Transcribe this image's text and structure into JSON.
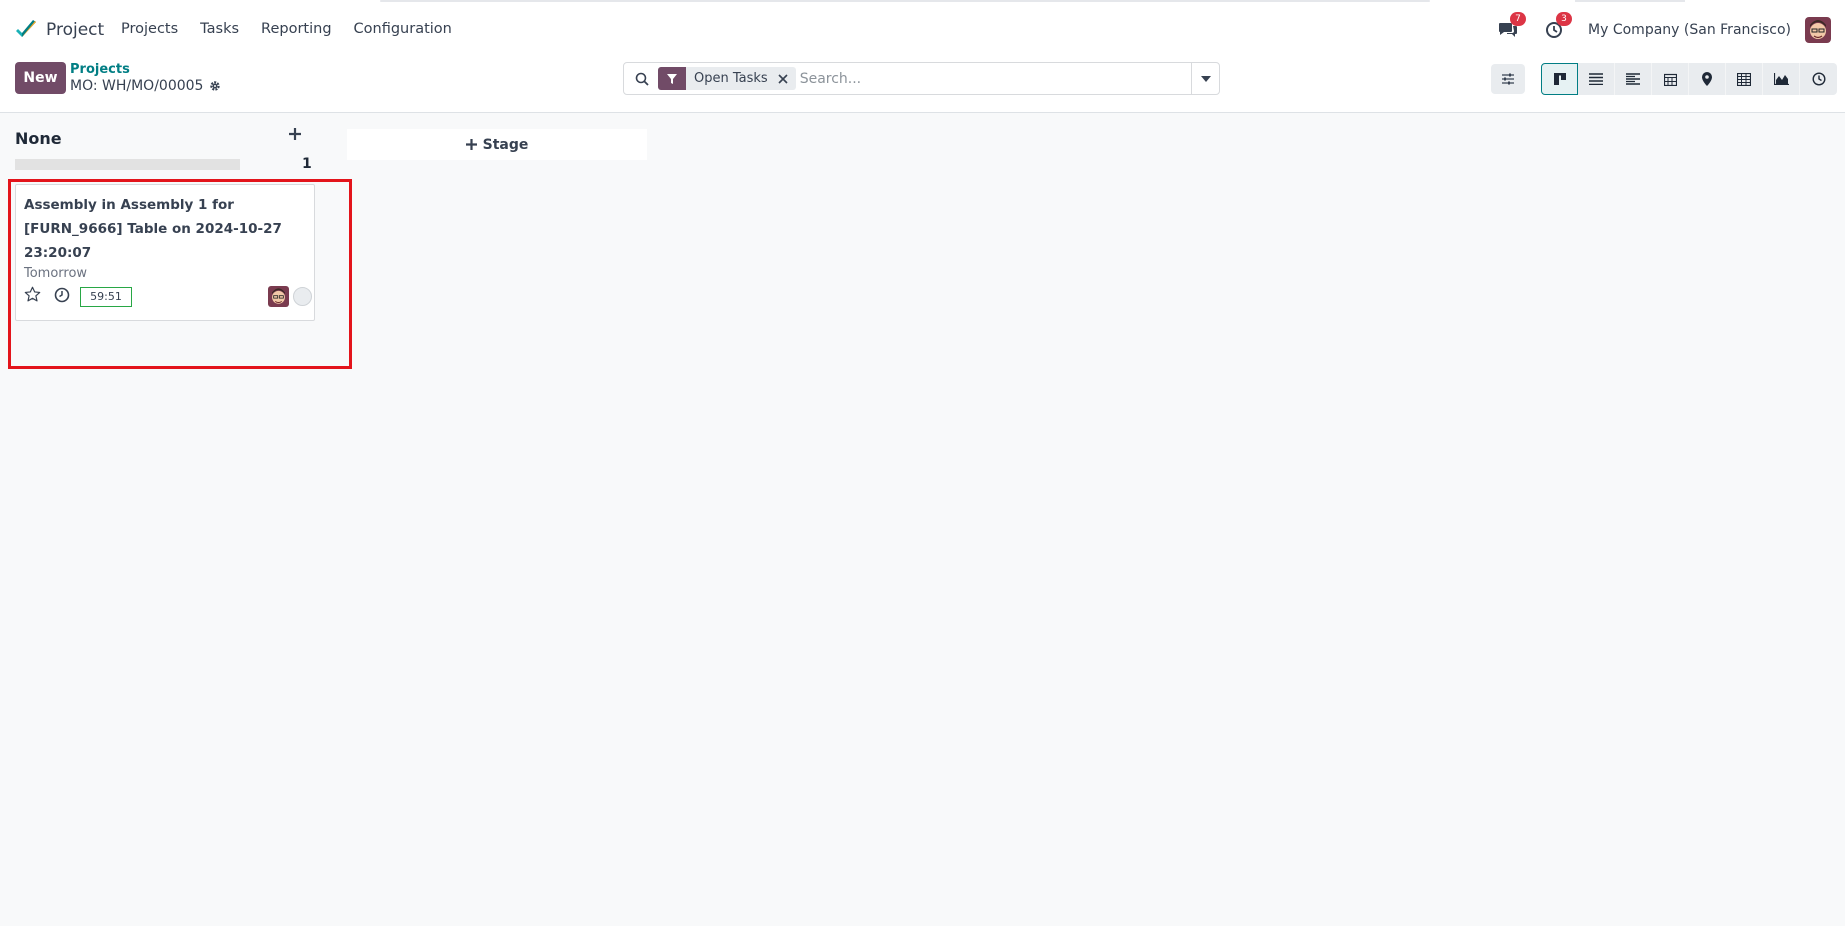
{
  "app": {
    "name": "Project",
    "menu": [
      "Projects",
      "Tasks",
      "Reporting",
      "Configuration"
    ]
  },
  "systray": {
    "messages_count": "7",
    "activities_count": "3",
    "company": "My Company (San Francisco)"
  },
  "control": {
    "new_label": "New",
    "breadcrumb_parent": "Projects",
    "breadcrumb_current": "MO: WH/MO/00005"
  },
  "search": {
    "facet_label": "Open Tasks",
    "placeholder": "Search..."
  },
  "views": [
    "kanban",
    "list",
    "activity-list",
    "calendar",
    "map",
    "pivot",
    "graph",
    "activity"
  ],
  "kanban": {
    "column": {
      "title": "None",
      "count": "1"
    },
    "card": {
      "title": "Assembly in Assembly 1 for [FURN_9666] Table on 2024-10-27 23:20:07",
      "date": "Tomorrow",
      "timer": "59:51"
    },
    "add_stage_label": "Stage"
  },
  "colors": {
    "brand": "#714b67",
    "link": "#017e84",
    "badge": "#dc3545",
    "highlight": "#e3141b",
    "timer_border": "#28a745"
  }
}
